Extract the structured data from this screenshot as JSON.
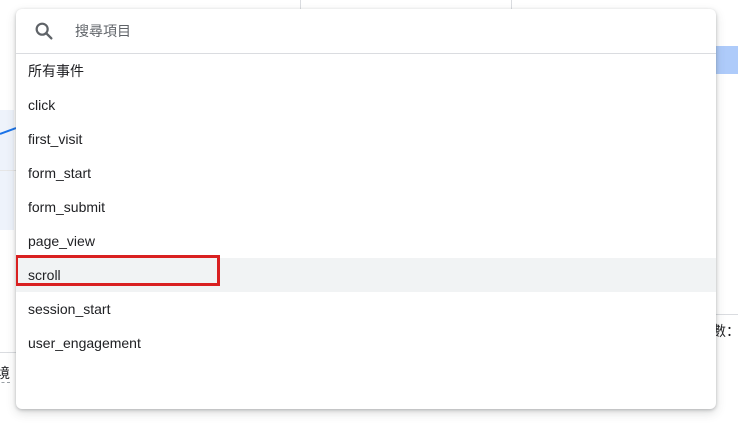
{
  "search": {
    "placeholder": "搜尋項目",
    "icon": "search-icon"
  },
  "event_list": {
    "items": [
      {
        "label": "所有事件"
      },
      {
        "label": "click"
      },
      {
        "label": "first_visit"
      },
      {
        "label": "form_start"
      },
      {
        "label": "form_submit"
      },
      {
        "label": "page_view"
      },
      {
        "label": "scroll",
        "highlighted": true
      },
      {
        "label": "session_start"
      },
      {
        "label": "user_engagement"
      }
    ],
    "highlight_color": "#d92020"
  },
  "background": {
    "left_label": "境",
    "right_label": "數："
  }
}
